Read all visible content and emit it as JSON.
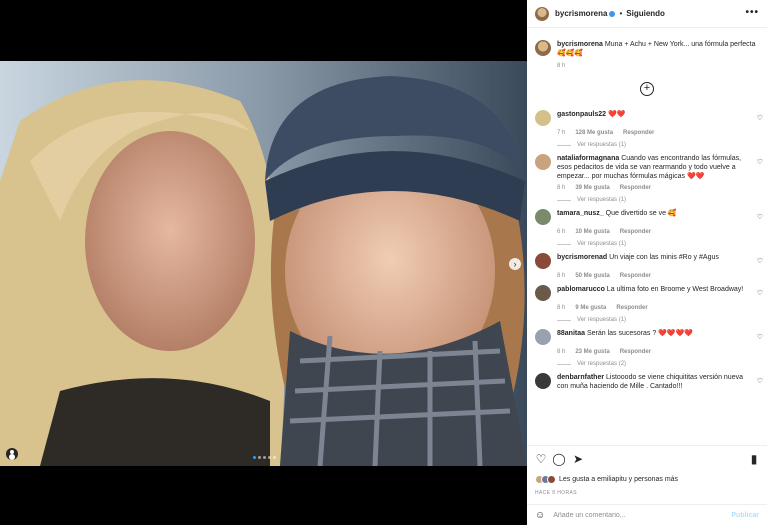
{
  "post": {
    "username": "bycrismorena",
    "separator": "•",
    "following_label": "Siguiendo",
    "more_label": "•••",
    "caption_text": " Muna + Achu + New York... una fórmula perfecta 🥰🥰🥰",
    "caption_time": "8 h",
    "plus_label": "+",
    "next_label": "›"
  },
  "comments": [
    {
      "user": "gastonpauls22",
      "text": " ❤️❤️",
      "time": "7 h",
      "likes": "128 Me gusta",
      "reply": "Responder",
      "replies": "Ver respuestas (1)",
      "avatar": "#d4c08a"
    },
    {
      "user": "nataliaformagnana",
      "text": " Cuando vas encontrando las fórmulas, esos pedacitos de vida se van rearmando y todo vuelve a empezar... por muchas fórmulas mágicas ❤️❤️",
      "time": "8 h",
      "likes": "39 Me gusta",
      "reply": "Responder",
      "replies": "Ver respuestas (1)",
      "avatar": "#c9a27e"
    },
    {
      "user": "tamara_nusz_",
      "text": " Que divertido se ve 🥰",
      "time": "6 h",
      "likes": "10 Me gusta",
      "reply": "Responder",
      "replies": "Ver respuestas (1)",
      "avatar": "#7a8a6a"
    },
    {
      "user": "bycrismorenad",
      "text": " Un viaje con las minis #Ro y #Agus",
      "time": "8 h",
      "likes": "50 Me gusta",
      "reply": "Responder",
      "replies": "",
      "avatar": "#8a4a3a"
    },
    {
      "user": "pablomarucco",
      "text": " La ultima foto en Broome y West Broadway!",
      "time": "8 h",
      "likes": "9 Me gusta",
      "reply": "Responder",
      "replies": "Ver respuestas (1)",
      "avatar": "#6a5a4a"
    },
    {
      "user": "88anitaa",
      "text": " Serán las sucesoras ? ❤️❤️❤️❤️",
      "time": "8 h",
      "likes": "23 Me gusta",
      "reply": "Responder",
      "replies": "Ver respuestas (2)",
      "avatar": "#9aa0b0"
    },
    {
      "user": "denbarnfather",
      "text": " Listooodo se viene chiquititas versión nueva con muña haciendo de Mille . Cantado!!!",
      "time": "",
      "likes": "",
      "reply": "",
      "replies": "",
      "avatar": "#3a3a3a"
    }
  ],
  "footer": {
    "likes_text": "Les gusta a emiliapitu y personas más",
    "time_ago": "HACE 8 HORAS",
    "add_placeholder": "Añade un comentario...",
    "post_label": "Publicar",
    "emoji_icon": "☺"
  },
  "colors": {
    "accent": "#3897f0",
    "muted": "#8e8e8e",
    "text": "#262626"
  }
}
